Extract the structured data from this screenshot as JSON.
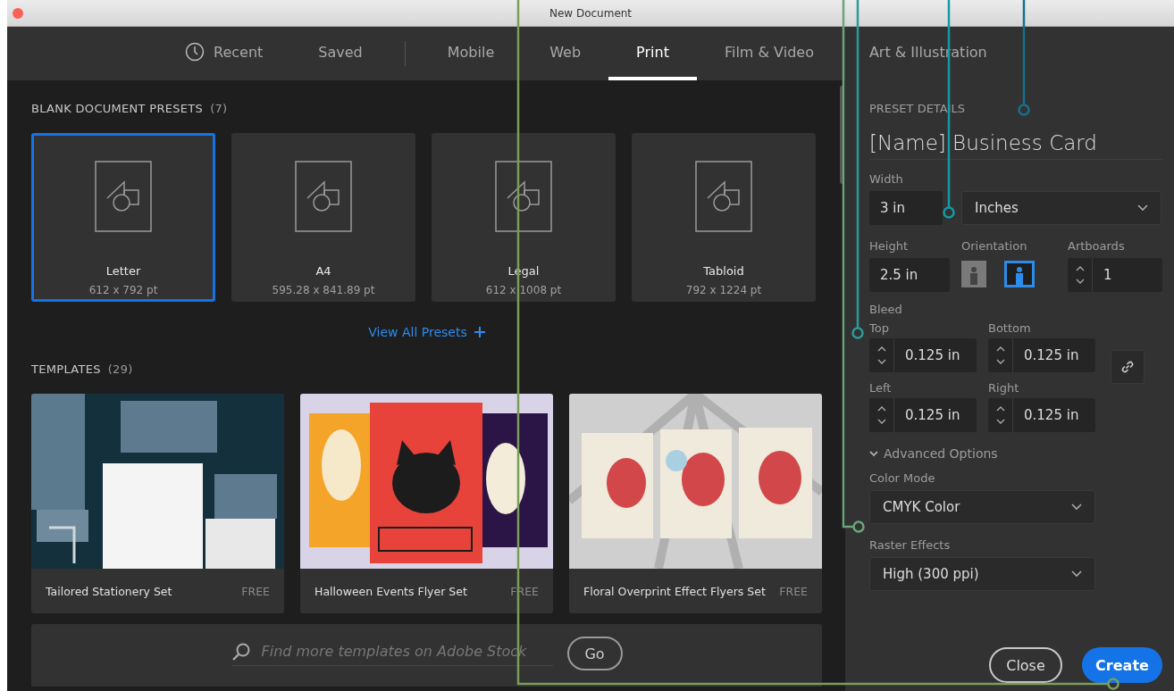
{
  "window": {
    "title": "New Document"
  },
  "tabs": [
    {
      "label": "Recent",
      "kind": "clock",
      "selected": false
    },
    {
      "label": "Saved",
      "kind": "plain",
      "selected": false
    },
    {
      "label": "Mobile",
      "kind": "divided",
      "selected": false
    },
    {
      "label": "Web",
      "kind": "plain",
      "selected": false
    },
    {
      "label": "Print",
      "kind": "plain",
      "selected": true
    },
    {
      "label": "Film & Video",
      "kind": "plain",
      "selected": false
    },
    {
      "label": "Art & Illustration",
      "kind": "plain",
      "selected": false
    }
  ],
  "presets": {
    "heading": "BLANK DOCUMENT PRESETS",
    "count": "(7)",
    "view_all": "View All Presets",
    "items": [
      {
        "name": "Letter",
        "size": "612 x 792 pt",
        "selected": true
      },
      {
        "name": "A4",
        "size": "595.28 x 841.89 pt",
        "selected": false
      },
      {
        "name": "Legal",
        "size": "612 x 1008 pt",
        "selected": false
      },
      {
        "name": "Tabloid",
        "size": "792 x 1224 pt",
        "selected": false
      }
    ]
  },
  "templates": {
    "heading": "TEMPLATES",
    "count": "(29)",
    "items": [
      {
        "name": "Tailored Stationery Set",
        "price": "FREE",
        "kind": "stationery"
      },
      {
        "name": "Halloween Events Flyer Set",
        "price": "FREE",
        "kind": "halloween"
      },
      {
        "name": "Floral Overprint Effect Flyers Set",
        "price": "FREE",
        "kind": "floral"
      }
    ]
  },
  "stock_search": {
    "placeholder": "Find more templates on Adobe Stock",
    "button": "Go"
  },
  "details": {
    "heading": "PRESET DETAILS",
    "name": "[Name] Business Card",
    "width_label": "Width",
    "width": "3 in",
    "units": "Inches",
    "height_label": "Height",
    "height": "2.5 in",
    "orientation_label": "Orientation",
    "orientations": [
      {
        "kind": "portrait",
        "selected": false
      },
      {
        "kind": "landscape",
        "selected": true
      }
    ],
    "artboards_label": "Artboards",
    "artboards": "1",
    "bleed_label": "Bleed",
    "bleed": [
      {
        "label": "Top",
        "value": "0.125 in"
      },
      {
        "label": "Bottom",
        "value": "0.125 in"
      },
      {
        "label": "Left",
        "value": "0.125 in"
      },
      {
        "label": "Right",
        "value": "0.125 in"
      }
    ],
    "advanced": {
      "label": "Advanced Options",
      "expanded": true
    },
    "color_mode_label": "Color Mode",
    "color_mode": "CMYK Color",
    "raster_label": "Raster Effects",
    "raster": "High (300 ppi)"
  },
  "buttons": {
    "close": "Close",
    "create": "Create"
  }
}
